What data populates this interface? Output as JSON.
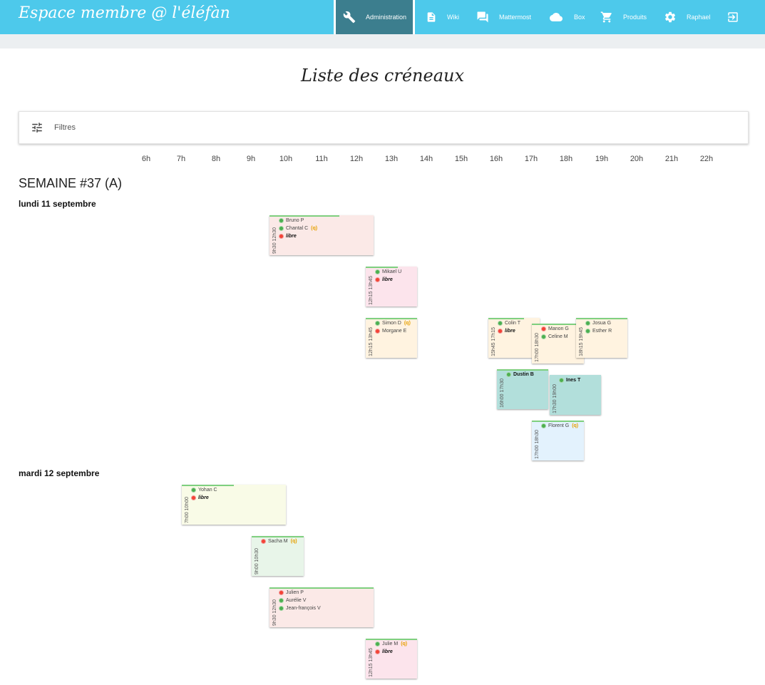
{
  "header": {
    "brand": "Espace membre @ l'éléfàn",
    "nav": [
      {
        "label": "Administration"
      },
      {
        "label": "Wiki"
      },
      {
        "label": "Mattermost"
      },
      {
        "label": "Box"
      },
      {
        "label": "Produits"
      },
      {
        "label": "Raphael"
      }
    ],
    "icons": [
      "wrench-icon",
      "document-icon",
      "chat-icon",
      "cloud-icon",
      "cart-icon",
      "gear-icon",
      "logout-icon"
    ]
  },
  "page": {
    "title": "Liste des créneaux",
    "filters_label": "Filtres"
  },
  "hours": [
    "6h",
    "7h",
    "8h",
    "9h",
    "10h",
    "11h",
    "12h",
    "13h",
    "14h",
    "15h",
    "16h",
    "17h",
    "18h",
    "19h",
    "20h",
    "21h",
    "22h"
  ],
  "week": {
    "title": "SEMAINE #37 (A)",
    "days": [
      {
        "label": "lundi 11 septembre"
      },
      {
        "label": "mardi 12 septembre"
      }
    ]
  },
  "slots": [
    {
      "time": "9h30 12h30",
      "color": "#fbe9e7",
      "people": [
        {
          "name": "Bruno P",
          "status": "green"
        },
        {
          "name": "Chantal C",
          "status": "green",
          "tag": "(q)"
        },
        {
          "name": "libre",
          "status": "red",
          "free": true
        }
      ]
    },
    {
      "time": "12h15 13h45",
      "color": "#fce4ec",
      "people": [
        {
          "name": "Mikael U",
          "status": "green"
        },
        {
          "name": "libre",
          "status": "red",
          "free": true
        }
      ]
    },
    {
      "time": "12h15 13h45",
      "color": "#fff3e0",
      "people": [
        {
          "name": "Simon D",
          "status": "green",
          "tag": "(q)"
        },
        {
          "name": "Morgane E",
          "status": "red"
        }
      ]
    },
    {
      "time": "15h45 17h15",
      "color": "#fff3e0",
      "people": [
        {
          "name": "Colin T",
          "status": "green"
        },
        {
          "name": "libre",
          "status": "red",
          "free": true
        }
      ]
    },
    {
      "time": "17h00 18h30",
      "color": "#fff3e0",
      "people": [
        {
          "name": "Manon G",
          "status": "red"
        },
        {
          "name": "Celine M",
          "status": "green"
        }
      ]
    },
    {
      "time": "18h15 19h45",
      "color": "#fff3e0",
      "people": [
        {
          "name": "Josua G",
          "status": "green"
        },
        {
          "name": "Esther R",
          "status": "green"
        }
      ]
    },
    {
      "time": "16h00 17h30",
      "color": "#b2dfdb",
      "people": [
        {
          "name": "Dustin B",
          "status": "green",
          "bold": true
        }
      ]
    },
    {
      "time": "17h30 19h00",
      "color": "#b2dfdb",
      "people": [
        {
          "name": "Ines T",
          "status": "green",
          "bold": true
        }
      ]
    },
    {
      "time": "17h00 18h30",
      "color": "#e3f2fd",
      "people": [
        {
          "name": "Florent G",
          "status": "green",
          "tag": "(q)"
        }
      ]
    },
    {
      "time": "7h00 10h00",
      "color": "#f9fbe7",
      "people": [
        {
          "name": "Yohan C",
          "status": "green"
        },
        {
          "name": "libre",
          "status": "red",
          "free": true
        }
      ]
    },
    {
      "time": "9h00 10h30",
      "color": "#e8f5e9",
      "people": [
        {
          "name": "Sacha M",
          "status": "red",
          "tag": "(q)"
        }
      ]
    },
    {
      "time": "9h30 12h30",
      "color": "#fbe9e7",
      "people": [
        {
          "name": "Julien P",
          "status": "red"
        },
        {
          "name": "Aurélie V",
          "status": "green"
        },
        {
          "name": "Jean-françois V",
          "status": "green"
        }
      ]
    },
    {
      "time": "12h15 13h45",
      "color": "#fce4ec",
      "people": [
        {
          "name": "Julie M",
          "status": "green",
          "tag": "(q)"
        },
        {
          "name": "libre",
          "status": "red",
          "free": true
        }
      ]
    }
  ]
}
